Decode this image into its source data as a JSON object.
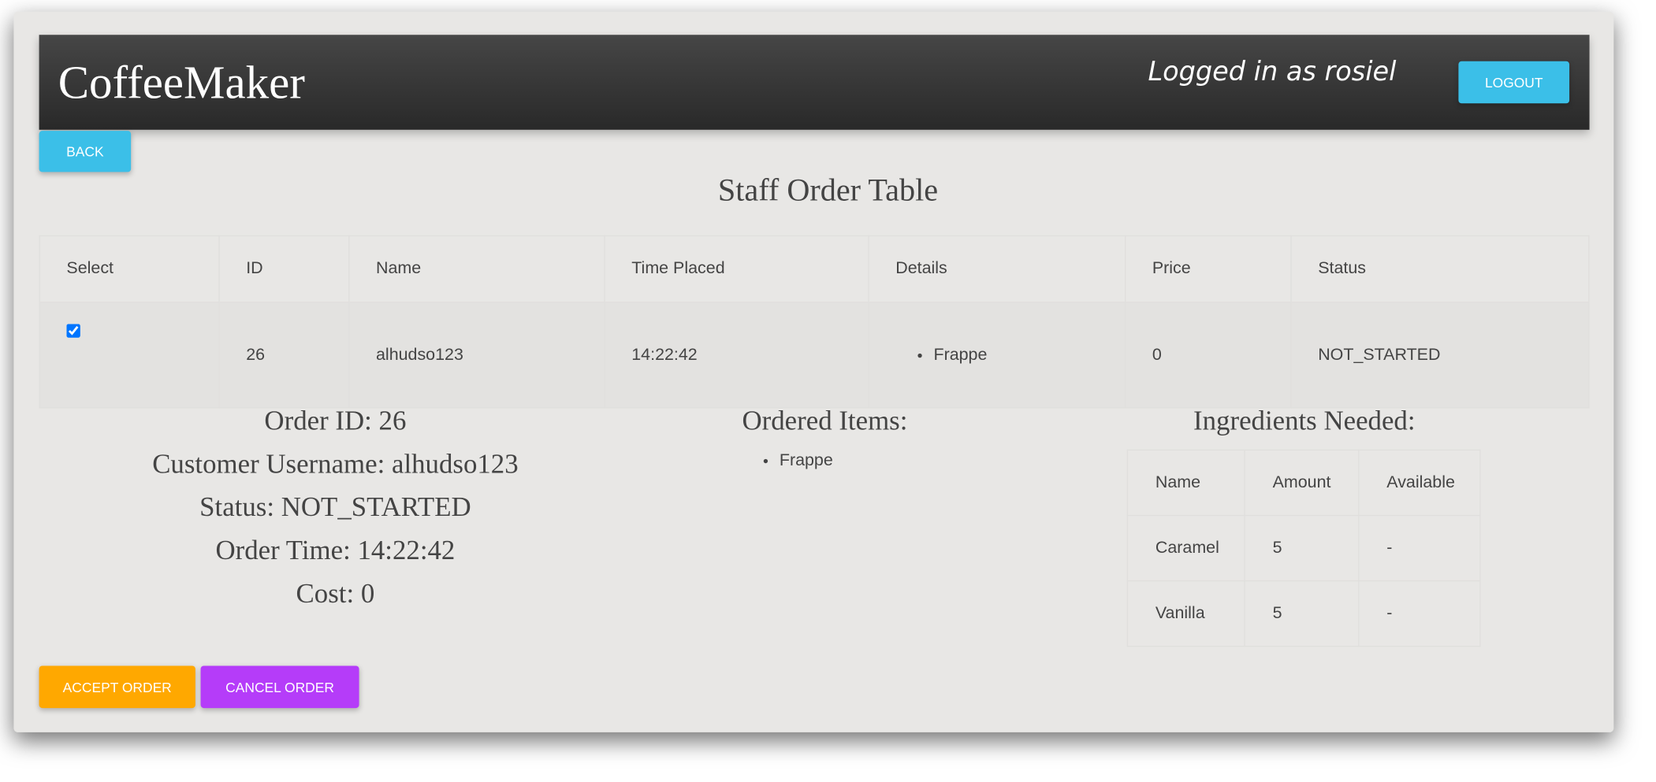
{
  "header": {
    "brand": "CoffeeMaker",
    "logged_in": "Logged in as rosiel",
    "logout_label": "LOGOUT"
  },
  "back_label": "BACK",
  "page_title": "Staff Order Table",
  "orders": {
    "columns": [
      "Select",
      "ID",
      "Name",
      "Time Placed",
      "Details",
      "Price",
      "Status"
    ],
    "rows": [
      {
        "selected": true,
        "id": "26",
        "name": "alhudso123",
        "time": "14:22:42",
        "details": [
          "Frappe"
        ],
        "price": "0",
        "status": "NOT_STARTED"
      }
    ]
  },
  "detail": {
    "order_id": "Order ID: 26",
    "customer": "Customer Username: alhudso123",
    "status": "Status: NOT_STARTED",
    "time": "Order Time: 14:22:42",
    "cost": "Cost: 0"
  },
  "ordered_items": {
    "heading": "Ordered Items:",
    "items": [
      "Frappe"
    ]
  },
  "ingredients": {
    "heading": "Ingredients Needed:",
    "columns": [
      "Name",
      "Amount",
      "Available"
    ],
    "rows": [
      {
        "name": "Caramel",
        "amount": "5",
        "available": "-"
      },
      {
        "name": "Vanilla",
        "amount": "5",
        "available": "-"
      }
    ]
  },
  "actions": {
    "accept_label": "ACCEPT ORDER",
    "cancel_label": "CANCEL ORDER",
    "accept_color": "#ffa800",
    "cancel_color": "#b53cf9",
    "primary_color": "#3bbfe8"
  }
}
